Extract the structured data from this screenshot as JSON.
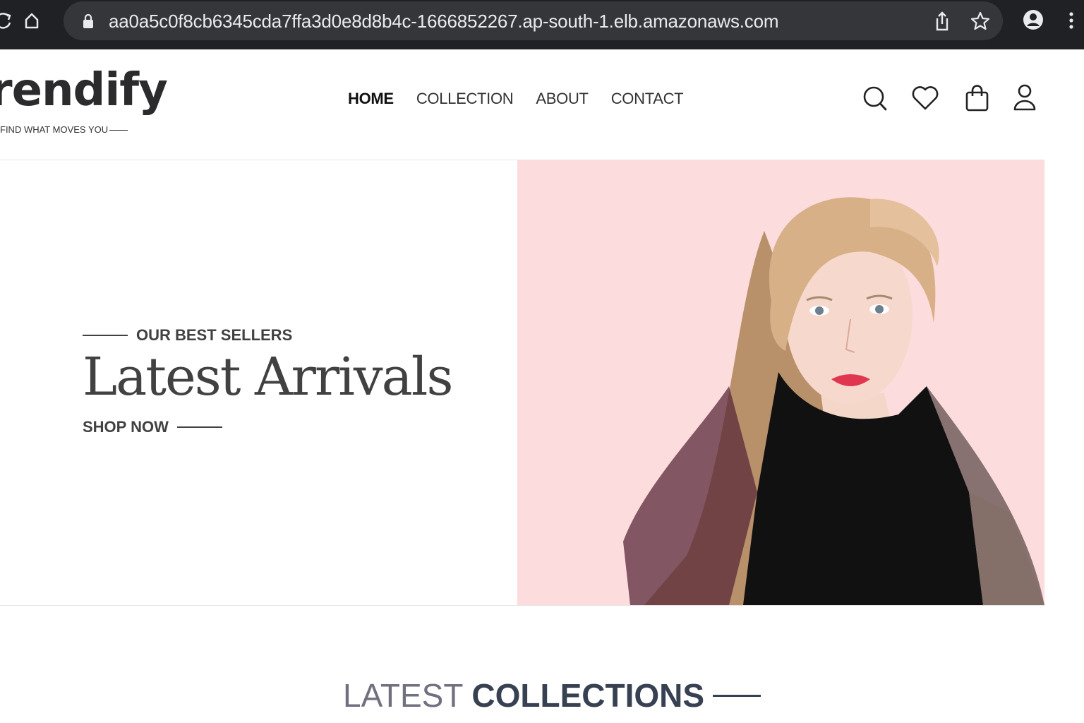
{
  "browser": {
    "url": "aa0a5c0f8cb6345cda7ffa3d0e8d8b4c-1666852267.ap-south-1.elb.amazonaws.com",
    "icons": [
      "refresh-icon",
      "home-icon",
      "lock-icon",
      "share-icon",
      "star-icon",
      "profile-icon",
      "menu-icon"
    ]
  },
  "brand": {
    "logo": "rendify",
    "tagline": "FIND WHAT MOVES YOU"
  },
  "nav": {
    "items": [
      "HOME",
      "COLLECTION",
      "ABOUT",
      "CONTACT"
    ],
    "active": "HOME"
  },
  "header_icons": [
    "search-icon",
    "heart-icon",
    "bag-icon",
    "user-icon"
  ],
  "hero": {
    "eyebrow": "OUR BEST SELLERS",
    "title": "Latest Arrivals",
    "cta": "SHOP NOW",
    "image_bg": "#fcdcdc"
  },
  "section": {
    "title_part1": "LATEST",
    "title_part2": "COLLECTIONS"
  }
}
